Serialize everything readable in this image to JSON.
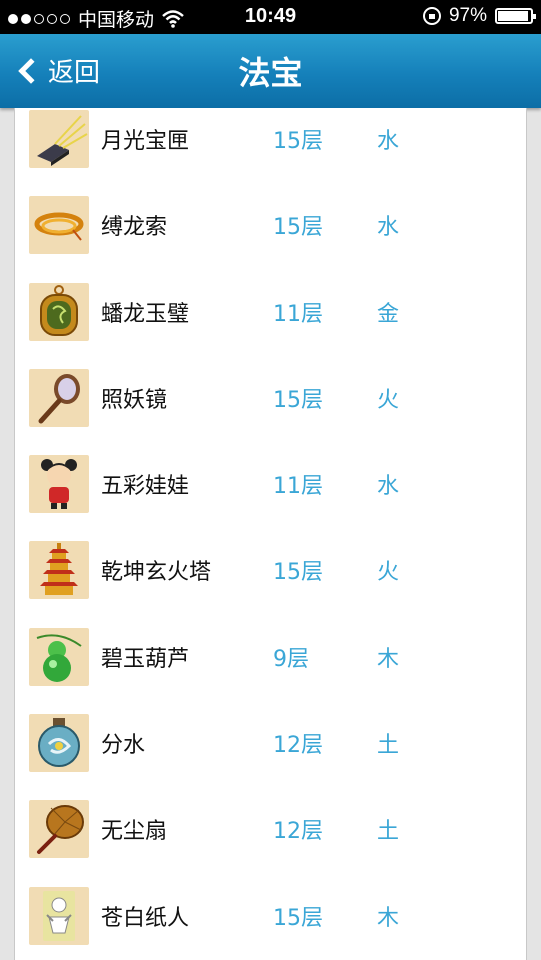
{
  "status_bar": {
    "carrier": "中国移动",
    "time": "10:49",
    "battery": "97%",
    "signal_bars_filled": 2,
    "signal_bars_total": 5
  },
  "nav": {
    "back_label": "返回",
    "title": "法宝"
  },
  "items": [
    {
      "name": "月光宝匣",
      "layer": "15层",
      "element": "水",
      "icon": "moonlight-box-icon"
    },
    {
      "name": "缚龙索",
      "layer": "15层",
      "element": "水",
      "icon": "dragon-rope-icon"
    },
    {
      "name": "蟠龙玉璧",
      "layer": "11层",
      "element": "金",
      "icon": "jade-disc-icon"
    },
    {
      "name": "照妖镜",
      "layer": "15层",
      "element": "火",
      "icon": "mirror-icon"
    },
    {
      "name": "五彩娃娃",
      "layer": "11层",
      "element": "水",
      "icon": "doll-icon"
    },
    {
      "name": "乾坤玄火塔",
      "layer": "15层",
      "element": "火",
      "icon": "pagoda-icon"
    },
    {
      "name": "碧玉葫芦",
      "layer": "9层",
      "element": "木",
      "icon": "gourd-icon"
    },
    {
      "name": "分水",
      "layer": "12层",
      "element": "土",
      "icon": "water-bottle-icon"
    },
    {
      "name": "无尘扇",
      "layer": "12层",
      "element": "土",
      "icon": "fan-icon"
    },
    {
      "name": "苍白纸人",
      "layer": "15层",
      "element": "木",
      "icon": "paper-doll-icon"
    }
  ]
}
